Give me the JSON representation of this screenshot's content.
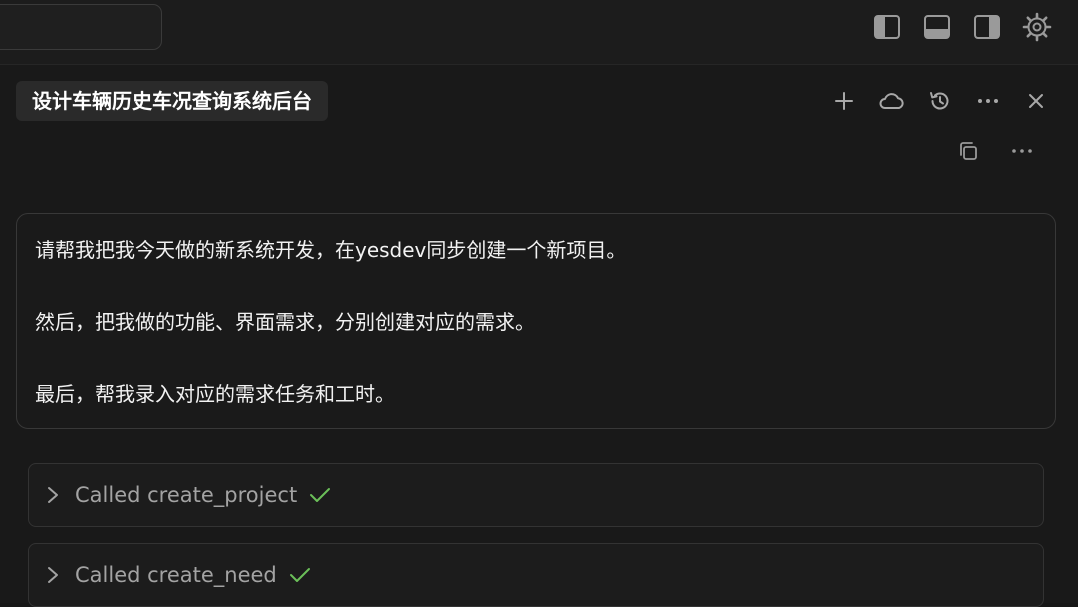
{
  "conversation": {
    "title": "设计车辆历史车况查询系统后台"
  },
  "message": {
    "lines": [
      "请帮我把我今天做的新系统开发，在yesdev同步创建一个新项目。",
      "然后，把我做的功能、界面需求，分别创建对应的需求。",
      "最后，帮我录入对应的需求任务和工时。"
    ]
  },
  "tool_calls": [
    {
      "label": "Called create_project",
      "status": "success"
    },
    {
      "label": "Called create_need",
      "status": "success"
    }
  ],
  "icons": {
    "topbar": [
      "sidebar-left-icon",
      "panel-bottom-icon",
      "sidebar-right-icon",
      "gear-icon"
    ],
    "header": [
      "plus-icon",
      "cloud-icon",
      "history-icon",
      "more-icon",
      "close-icon"
    ],
    "sub": [
      "copy-icon",
      "more-icon"
    ]
  },
  "colors": {
    "background": "#171717",
    "check": "#6bbf59",
    "muted_text": "#a3a3a3"
  }
}
